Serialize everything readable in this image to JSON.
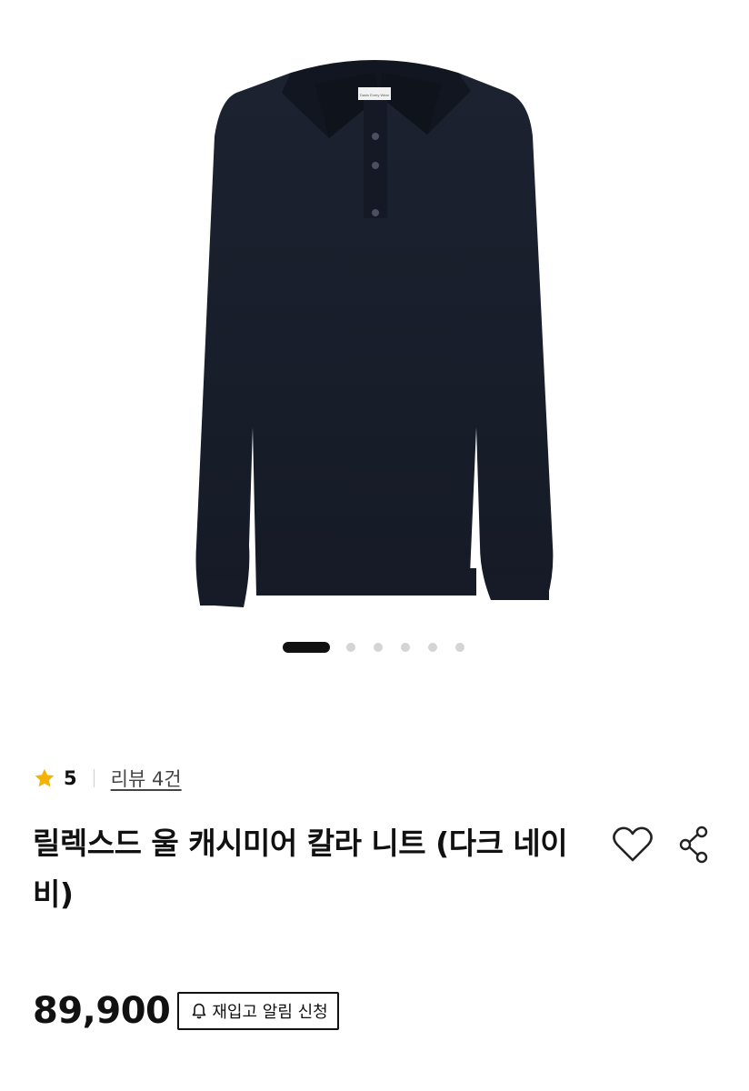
{
  "gallery": {
    "image_alt": "product-photo",
    "image_label_text": "Dasis Every Wear",
    "slide_count": 6,
    "active_slide": 1
  },
  "rating": {
    "value": "5",
    "review_text": "리뷰 4건",
    "star_color": "#F5B301"
  },
  "product": {
    "title": "릴렉스드 울 캐시미어 칼라 니트 (다크 네이비)",
    "price": "89,900"
  },
  "actions": {
    "wishlist_icon": "heart-icon",
    "share_icon": "share-icon",
    "restock_label": "재입고 알림 신청",
    "restock_icon": "bell-icon"
  }
}
